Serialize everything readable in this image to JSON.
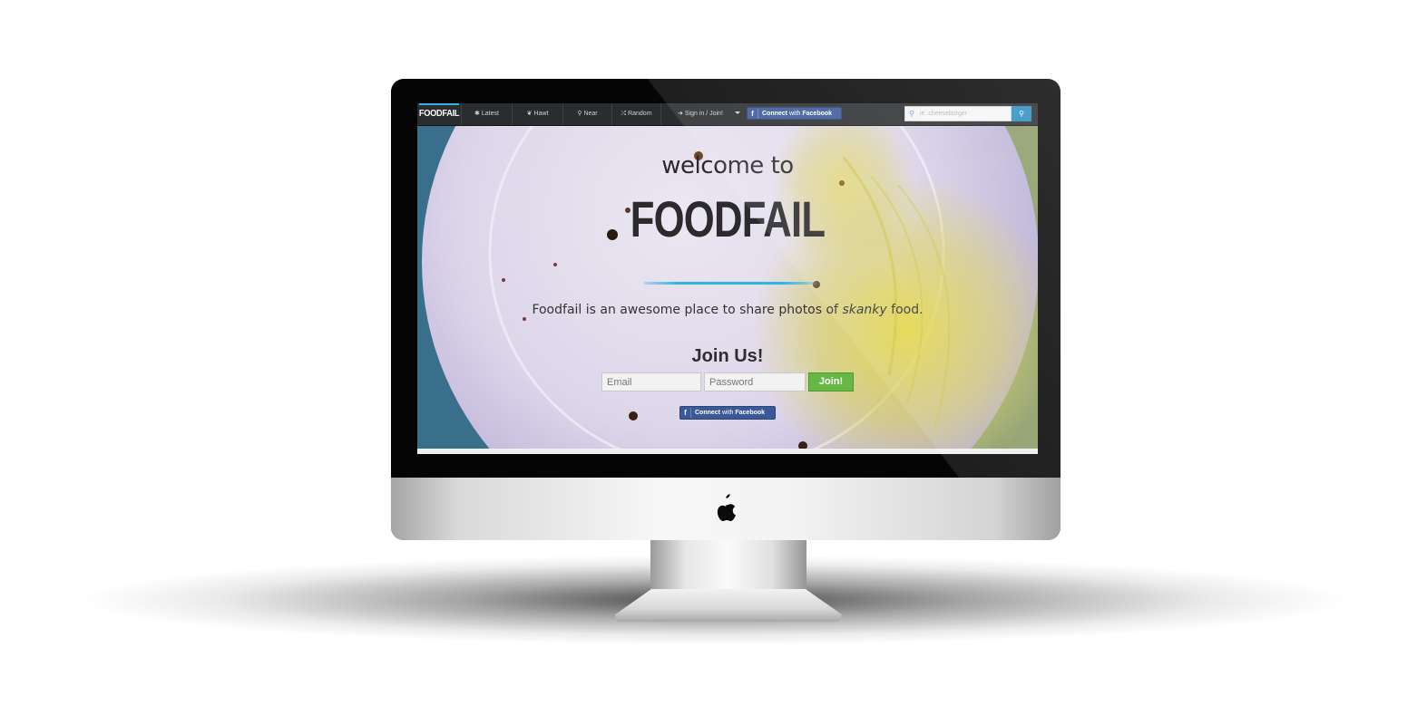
{
  "navbar": {
    "brand": "FOODFAIL",
    "items": [
      {
        "icon": "asterisk-icon",
        "glyph": "✱",
        "label": "Latest"
      },
      {
        "icon": "fire-icon",
        "glyph": "❦",
        "label": "Hawt"
      },
      {
        "icon": "map-marker-icon",
        "glyph": "⚲",
        "label": "Near"
      },
      {
        "icon": "random-icon",
        "glyph": "⤮",
        "label": "Random"
      },
      {
        "icon": "sign-in-icon",
        "glyph": "➜",
        "label": "Sign in / Join!"
      }
    ],
    "facebook": {
      "strong": "Connect",
      "light": "with",
      "rest": "Facebook",
      "icon": "facebook-icon"
    },
    "search": {
      "placeholder": "ie. cheeseburger",
      "icon": "search-icon"
    }
  },
  "hero": {
    "welcome": "welcome to",
    "title": "FOODFAIL",
    "tagline_start": "Foodfail is an awesome place to share photos of",
    "tagline_em": "skanky",
    "tagline_end": "food."
  },
  "join": {
    "title": "Join Us!",
    "email_placeholder": "Email",
    "password_placeholder": "Password",
    "button": "Join!",
    "facebook": {
      "strong": "Connect",
      "light": "with",
      "rest": "Facebook"
    }
  },
  "colors": {
    "accent": "#2fb3e8",
    "join_green": "#67b745",
    "facebook_blue": "#3b5998",
    "navbar": "#2a2c2f"
  }
}
